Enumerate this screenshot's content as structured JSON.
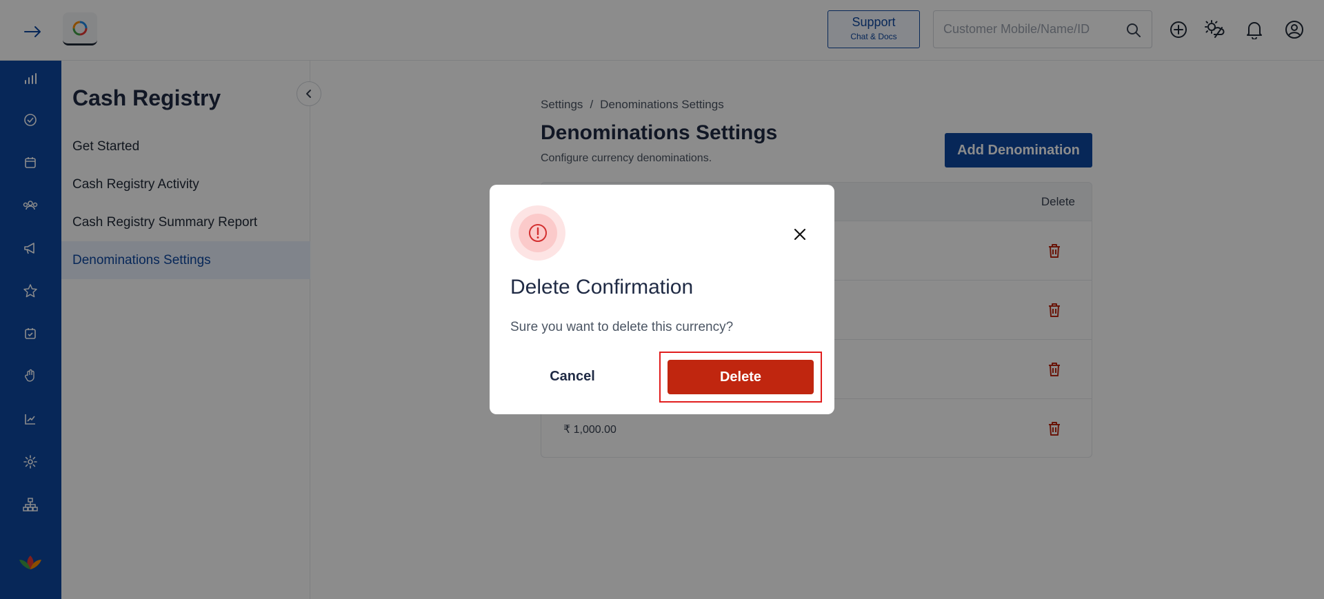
{
  "topbar": {
    "support_title": "Support",
    "support_sub": "Chat & Docs",
    "search_placeholder": "Customer Mobile/Name/ID",
    "icons": [
      "arrow-right-icon",
      "app-logo-icon",
      "search-icon",
      "plus-circle-icon",
      "weather-icon",
      "bell-icon",
      "user-circle-icon"
    ]
  },
  "rail": {
    "icons": [
      "dashboard-chart-icon",
      "check-circle-icon",
      "calendar-icon",
      "users-group-icon",
      "megaphone-icon",
      "star-icon",
      "calendar-check-icon",
      "hand-icon",
      "trend-chart-icon",
      "gear-icon",
      "org-chart-icon",
      "lotus-logo-icon"
    ]
  },
  "sidepanel": {
    "title": "Cash Registry",
    "items": [
      {
        "label": "Get Started",
        "active": false
      },
      {
        "label": "Cash Registry Activity",
        "active": false
      },
      {
        "label": "Cash Registry Summary Report",
        "active": false
      },
      {
        "label": "Denominations Settings",
        "active": true
      }
    ]
  },
  "main": {
    "breadcrumb": {
      "root": "Settings",
      "sep": "/",
      "current": "Denominations Settings"
    },
    "title": "Denominations Settings",
    "subtitle": "Configure currency denominations.",
    "add_button": "Add Denomination",
    "table": {
      "delete_header": "Delete",
      "rows": [
        {
          "amount": ""
        },
        {
          "amount": ""
        },
        {
          "amount": ""
        },
        {
          "amount": "₹ 1,000.00"
        }
      ]
    }
  },
  "modal": {
    "title": "Delete Confirmation",
    "message": "Sure you want to delete this currency?",
    "cancel_label": "Cancel",
    "delete_label": "Delete"
  },
  "colors": {
    "brand": "#0d47a1",
    "danger": "#c0260f",
    "highlight": "#e11d1d"
  }
}
